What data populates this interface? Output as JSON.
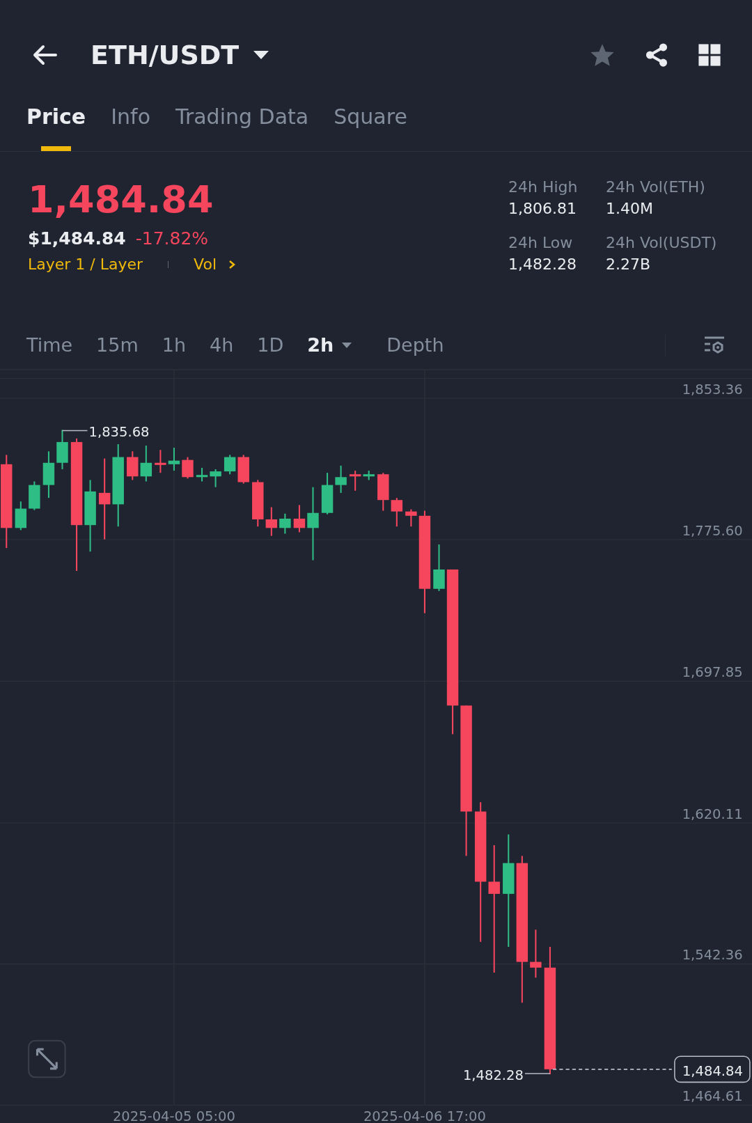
{
  "header": {
    "pair": "ETH/USDT",
    "favorite": false
  },
  "tabs": [
    {
      "label": "Price",
      "selected": true
    },
    {
      "label": "Info",
      "selected": false
    },
    {
      "label": "Trading Data",
      "selected": false
    },
    {
      "label": "Square",
      "selected": false
    }
  ],
  "price": {
    "last": "1,484.84",
    "usd": "$1,484.84",
    "change": "-17.82%",
    "tags": [
      "Layer 1 / Layer",
      "Vol"
    ]
  },
  "stats": [
    {
      "label": "24h High",
      "value": "1,806.81"
    },
    {
      "label": "24h Vol(ETH)",
      "value": "1.40M"
    },
    {
      "label": "24h Low",
      "value": "1,482.28"
    },
    {
      "label": "24h Vol(USDT)",
      "value": "2.27B"
    }
  ],
  "intervals": [
    {
      "label": "Time",
      "selected": false
    },
    {
      "label": "15m",
      "selected": false
    },
    {
      "label": "1h",
      "selected": false
    },
    {
      "label": "4h",
      "selected": false
    },
    {
      "label": "1D",
      "selected": false
    },
    {
      "label": "2h",
      "selected": true,
      "kind": "dropdown"
    },
    {
      "label": "Depth",
      "selected": false
    }
  ],
  "chart": {
    "price_axis": [
      "1,853.36",
      "1,775.60",
      "1,697.85",
      "1,620.11",
      "1,542.36",
      "1,464.61"
    ],
    "time_axis": [
      "2025-04-05 05:00",
      "2025-04-06 17:00"
    ],
    "high_marker": "1,835.68",
    "low_marker": "1,482.28",
    "last_price_tag": "1,484.84"
  }
}
